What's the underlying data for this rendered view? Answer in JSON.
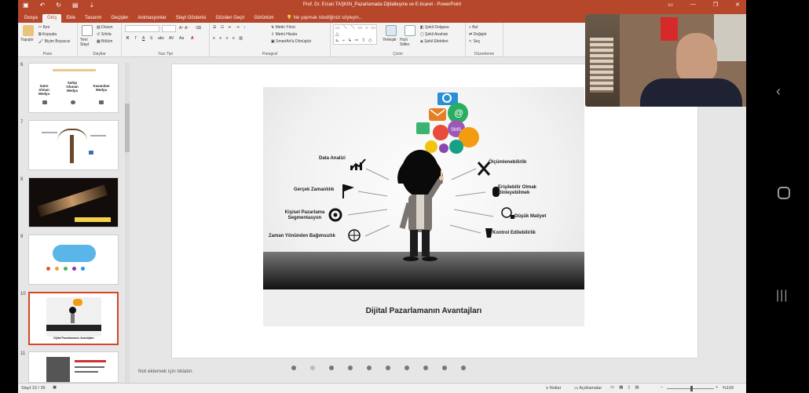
{
  "window": {
    "title": "Prof. Dr. Ercan TAŞKIN_Pazarlamada Dijitalleşme ve E-ticaret - PowerPoint",
    "colors": {
      "accent": "#b7472a",
      "selected_border": "#d24726"
    }
  },
  "tabs": [
    "Dosya",
    "Giriş",
    "Ekle",
    "Tasarım",
    "Geçişler",
    "Animasyonlar",
    "Slayt Gösterisi",
    "Gözden Geçir",
    "Görünüm"
  ],
  "tell_me": "Ne yapmak istediğinizi söyleyin...",
  "ribbon": {
    "pano": {
      "label": "Pano",
      "paste": "Yapıştır",
      "cut": "Kes",
      "copy": "Kopyala",
      "format_painter": "Biçim Boyacısı"
    },
    "slaytlar": {
      "label": "Slaytlar",
      "new_slide": "Yeni Slayt",
      "layout": "Düzen",
      "reset": "Sıfırla",
      "section": "Bölüm"
    },
    "yazi_tipi": {
      "label": "Yazı Tipi",
      "b": "K",
      "i": "T",
      "u": "A",
      "s": "S",
      "aa": "Aa",
      "font_color": "A"
    },
    "paragraf": {
      "label": "Paragraf",
      "text_direction": "Metin Yönü",
      "align_text": "Metni Hizala",
      "smartart": "SmartArt'a Dönüştür"
    },
    "cizim": {
      "label": "Çizim",
      "arrange": "Yerleştir",
      "quick_styles": "Hızlı Stiller",
      "fill": "Şekil Dolgusu",
      "outline": "Şekil Anahatı",
      "effects": "Şekil Efektleri"
    },
    "duzenleme": {
      "label": "Düzenleme",
      "find": "Bul",
      "replace": "Değiştir",
      "select": "Seç"
    }
  },
  "thumbnails": [
    {
      "num": "6",
      "headings": [
        "Satın Alınan Medya",
        "Sahip Olunan Medya",
        "Kazanılan Medya"
      ]
    },
    {
      "num": "7"
    },
    {
      "num": "8"
    },
    {
      "num": "9"
    },
    {
      "num": "10",
      "caption": "Dijital Pazarlamanın Avantajları"
    },
    {
      "num": "11"
    }
  ],
  "slide": {
    "title": "Dijital Pazarlamanın Avantajları",
    "left_items": [
      "Data Analizi",
      "Gerçek Zamanlılık",
      "Kişisel Pazarlama Segmentasyon",
      "Zaman Yönünden Bağımsızlık"
    ],
    "right_items": [
      "Ölçümlenebilirlik",
      "Erişilebilir Olmak Dinleyebilmek",
      "Düşük Maliyet",
      "Kontrol Edilebilirlik"
    ],
    "bubble_texts": [
      "@",
      "SMS"
    ]
  },
  "notes_placeholder": "Not eklemek için tıklatın",
  "status": {
    "slide_counter": "Slayt 10 / 39",
    "notes": "Notlar",
    "comments": "Açıklamalar",
    "zoom": "%109"
  }
}
